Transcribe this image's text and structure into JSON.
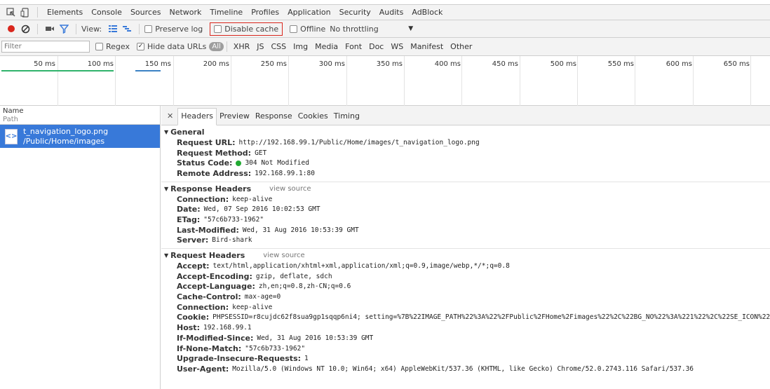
{
  "topbar": {
    "tabs": [
      "Elements",
      "Console",
      "Sources",
      "Network",
      "Timeline",
      "Profiles",
      "Application",
      "Security",
      "Audits",
      "AdBlock"
    ],
    "active_tab": "Network"
  },
  "toolbar": {
    "view_label": "View:",
    "preserve_log": "Preserve log",
    "disable_cache": "Disable cache",
    "offline": "Offline",
    "throttling": "No throttling"
  },
  "filterbar": {
    "placeholder": "Filter",
    "regex": "Regex",
    "hide_data_urls": "Hide data URLs",
    "all": "All",
    "types": [
      "XHR",
      "JS",
      "CSS",
      "Img",
      "Media",
      "Font",
      "Doc",
      "WS",
      "Manifest",
      "Other"
    ]
  },
  "timeline": {
    "labels": [
      "50 ms",
      "100 ms",
      "150 ms",
      "200 ms",
      "250 ms",
      "300 ms",
      "350 ms",
      "400 ms",
      "450 ms",
      "500 ms",
      "550 ms",
      "600 ms",
      "650 ms"
    ]
  },
  "list": {
    "col_name": "Name",
    "col_path": "Path",
    "request": {
      "name": "t_navigation_logo.png",
      "path": "/Public/Home/images"
    }
  },
  "detail": {
    "tabs": [
      "Headers",
      "Preview",
      "Response",
      "Cookies",
      "Timing"
    ],
    "active_tab": "Headers",
    "view_source": "view source",
    "general": {
      "title": "General",
      "rows": [
        {
          "name": "Request URL:",
          "value": "http://192.168.99.1/Public/Home/images/t_navigation_logo.png"
        },
        {
          "name": "Request Method:",
          "value": "GET"
        },
        {
          "name": "Status Code:",
          "value": "304 Not Modified"
        },
        {
          "name": "Remote Address:",
          "value": "192.168.99.1:80"
        }
      ]
    },
    "response_headers": {
      "title": "Response Headers",
      "rows": [
        {
          "name": "Connection:",
          "value": "keep-alive"
        },
        {
          "name": "Date:",
          "value": "Wed, 07 Sep 2016 10:02:53 GMT"
        },
        {
          "name": "ETag:",
          "value": "\"57c6b733-1962\""
        },
        {
          "name": "Last-Modified:",
          "value": "Wed, 31 Aug 2016 10:53:39 GMT"
        },
        {
          "name": "Server:",
          "value": "Bird-shark"
        }
      ]
    },
    "request_headers": {
      "title": "Request Headers",
      "rows": [
        {
          "name": "Accept:",
          "value": "text/html,application/xhtml+xml,application/xml;q=0.9,image/webp,*/*;q=0.8"
        },
        {
          "name": "Accept-Encoding:",
          "value": "gzip, deflate, sdch"
        },
        {
          "name": "Accept-Language:",
          "value": "zh,en;q=0.8,zh-CN;q=0.6"
        },
        {
          "name": "Cache-Control:",
          "value": "max-age=0"
        },
        {
          "name": "Connection:",
          "value": "keep-alive"
        },
        {
          "name": "Cookie:",
          "value": "PHPSESSID=r8cujdc62f8sua9gp1sqqp6ni4; setting=%7B%22IMAGE_PATH%22%3A%22%2FPublic%2FHome%2Fimages%22%2C%22BG_NO%22%3A%221%22%2C%22SE_ICON%22%3"
        },
        {
          "name": "Host:",
          "value": "192.168.99.1"
        },
        {
          "name": "If-Modified-Since:",
          "value": "Wed, 31 Aug 2016 10:53:39 GMT"
        },
        {
          "name": "If-None-Match:",
          "value": "\"57c6b733-1962\""
        },
        {
          "name": "Upgrade-Insecure-Requests:",
          "value": "1"
        },
        {
          "name": "User-Agent:",
          "value": "Mozilla/5.0 (Windows NT 10.0; Win64; x64) AppleWebKit/537.36 (KHTML, like Gecko) Chrome/52.0.2743.116 Safari/537.36"
        }
      ]
    }
  },
  "colors": {
    "record": "#d9261c",
    "selected_row": "#3879d9",
    "status_ok": "#22aa33",
    "timeline_blue": "#3b82c4",
    "timeline_green": "#2fb36b"
  }
}
